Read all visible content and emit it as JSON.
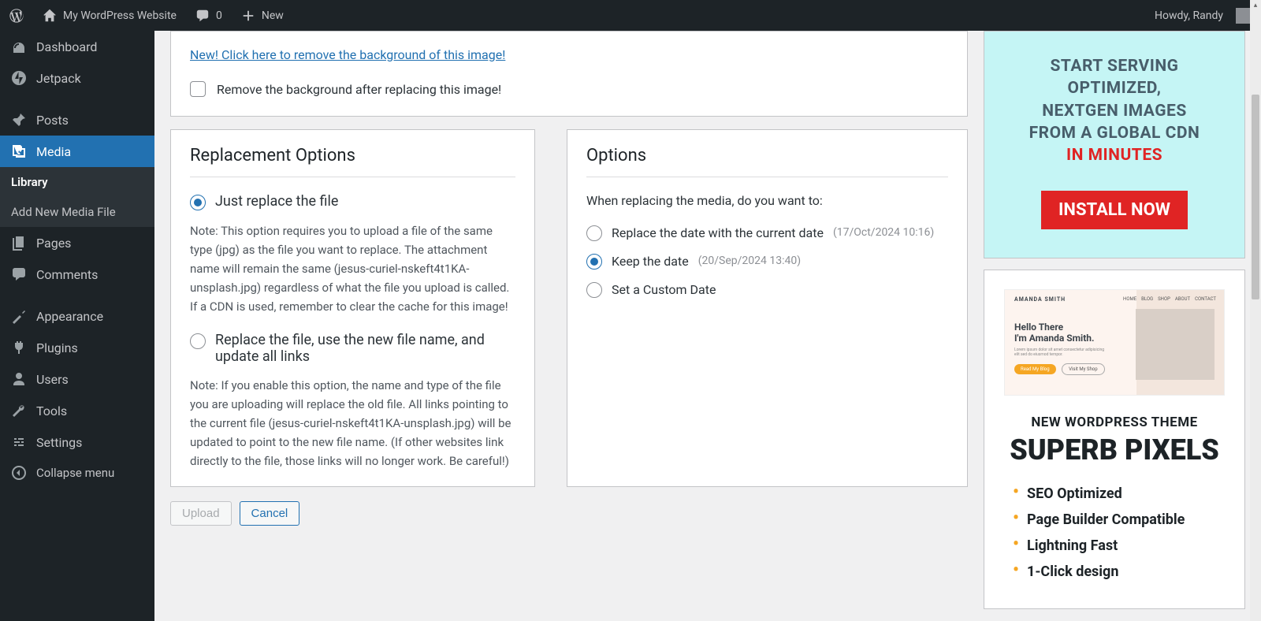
{
  "adminbar": {
    "site_title": "My WordPress Website",
    "comment_count": "0",
    "new_label": "New",
    "greeting": "Howdy, Randy"
  },
  "sidebar": {
    "dashboard": "Dashboard",
    "jetpack": "Jetpack",
    "posts": "Posts",
    "media": "Media",
    "media_sub_library": "Library",
    "media_sub_add": "Add New Media File",
    "pages": "Pages",
    "comments": "Comments",
    "appearance": "Appearance",
    "plugins": "Plugins",
    "users": "Users",
    "tools": "Tools",
    "settings": "Settings",
    "collapse": "Collapse menu"
  },
  "bg_remove": {
    "link": "New! Click here to remove the background of this image!",
    "checkbox_label": "Remove the background after replacing this image!"
  },
  "replacement": {
    "heading": "Replacement Options",
    "opt1_label": "Just replace the file",
    "opt1_note": "Note: This option requires you to upload a file of the same type (jpg) as the file you want to replace. The attachment name will remain the same (jesus-curiel-nskeft4t1KA-unsplash.jpg) regardless of what the file you upload is called. If a CDN is used, remember to clear the cache for this image!",
    "opt2_label": "Replace the file, use the new file name, and update all links",
    "opt2_note": "Note: If you enable this option, the name and type of the file you are uploading will replace the old file. All links pointing to the current file (jesus-curiel-nskeft4t1KA-unsplash.jpg) will be updated to point to the new file name. (If other websites link directly to the file, those links will no longer work. Be careful!)",
    "selected": "opt1"
  },
  "options_panel": {
    "heading": "Options",
    "question": "When replacing the media, do you want to:",
    "opt1": "Replace the date with the current date",
    "opt1_date": "(17/Oct/2024 10:16)",
    "opt2": "Keep the date",
    "opt2_date": "(20/Sep/2024 13:40)",
    "opt3": "Set a Custom Date",
    "selected": "opt2"
  },
  "actions": {
    "upload": "Upload",
    "cancel": "Cancel"
  },
  "promo_cdn": {
    "line1": "START SERVING",
    "line2": "OPTIMIZED,",
    "line3": "NEXTGEN IMAGES",
    "line4": "FROM A GLOBAL CDN",
    "line5": "IN MINUTES",
    "button": "INSTALL NOW"
  },
  "promo_theme": {
    "shot_name": "AMANDA SMITH",
    "shot_nav": [
      "HOME",
      "BLOG",
      "SHOP",
      "ABOUT",
      "CONTACT"
    ],
    "shot_hero1": "Hello There",
    "shot_hero2": "I'm Amanda Smith.",
    "shot_btn1": "Read My Blog",
    "shot_btn2": "Visit My Shop",
    "sub": "NEW WORDPRESS THEME",
    "big": "SUPERB PIXELS",
    "features": [
      "SEO Optimized",
      "Page Builder Compatible",
      "Lightning Fast",
      "1-Click design"
    ]
  }
}
